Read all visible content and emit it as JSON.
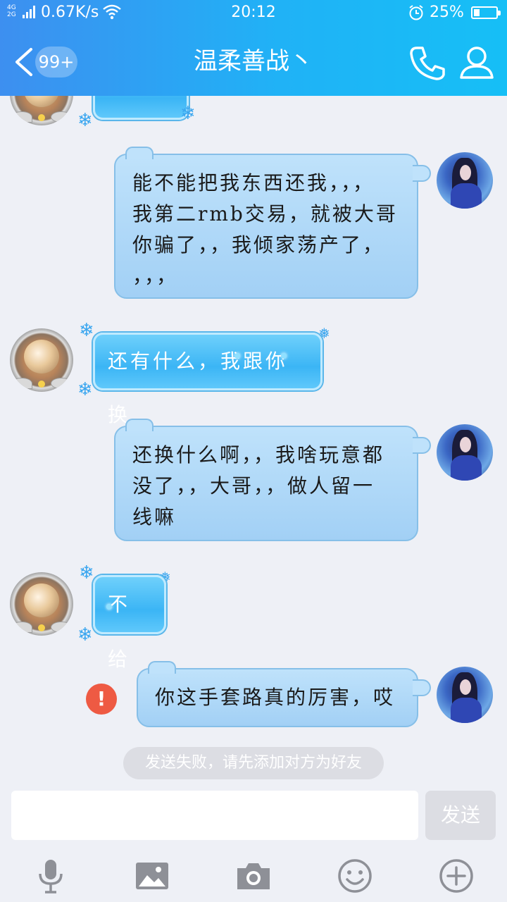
{
  "status_bar": {
    "network": "4G 2G",
    "speed": "0.67K/s",
    "time": "20:12",
    "battery_percent": "25%",
    "battery_level": 0.25
  },
  "header": {
    "unread_badge": "99+",
    "title": "温柔善战丶",
    "icons": {
      "back": "chevron-left-icon",
      "call": "phone-icon",
      "profile": "person-icon"
    }
  },
  "messages": [
    {
      "sender": "self",
      "text": "能不能把我东西还我，，，我第二rmb交易，就被大哥你骗了，，我倾家荡产了，，，，",
      "lines": [
        "能不能把我东西还我，，，",
        "我第二rmb交易，就被大哥",
        "你骗了，，我倾家荡产了，",
        "，，，"
      ]
    },
    {
      "sender": "other",
      "text": "还有什么，我跟你换"
    },
    {
      "sender": "self",
      "text": "还换什么啊，，我啥玩意都没了，，大哥，，做人留一线嘛",
      "lines": [
        "还换什么啊，，我啥玩意都",
        "没了，，大哥，，做人留一",
        "线嘛"
      ]
    },
    {
      "sender": "other",
      "text": "不给"
    },
    {
      "sender": "self",
      "text": "你这手套路真的厉害，哎",
      "failed": true
    }
  ],
  "failed_indicator": "!",
  "notice": "发送失败，请先添加对方为好友",
  "input": {
    "value": "",
    "placeholder": ""
  },
  "send_label": "发送",
  "toolbar_icons": [
    "microphone-icon",
    "image-icon",
    "camera-icon",
    "emoji-icon",
    "plus-icon"
  ],
  "colors": {
    "header_start": "#3d8ff0",
    "header_end": "#16bff6",
    "error": "#ee5a43",
    "self_bubble": "#a2d0f5",
    "other_bubble": "#3bb5f5"
  }
}
